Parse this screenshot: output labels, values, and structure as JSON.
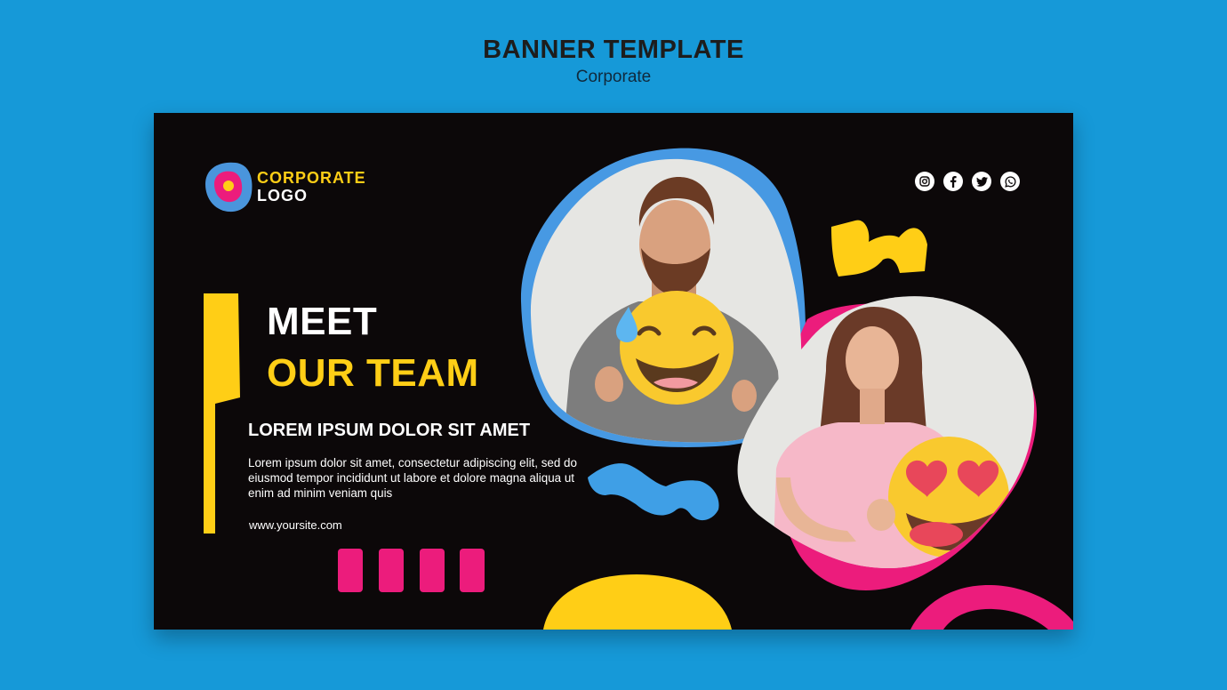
{
  "page": {
    "title": "BANNER TEMPLATE",
    "subtitle": "Corporate"
  },
  "banner": {
    "logo": {
      "line1": "CORPORATE",
      "line2": "LOGO"
    },
    "headline": {
      "line1": "MEET",
      "line2": "OUR TEAM"
    },
    "subheading": "LOREM IPSUM DOLOR SIT AMET",
    "body": "Lorem ipsum dolor sit amet, consectetur adipiscing elit, sed do eiusmod tempor incididunt ut labore et dolore magna aliqua ut enim ad minim veniam quis",
    "website": "www.yoursite.com",
    "social_icons": [
      "instagram-icon",
      "facebook-icon",
      "twitter-icon",
      "whatsapp-icon"
    ]
  },
  "colors": {
    "page_background": "#1699d8",
    "banner_background": "#0c0809",
    "accent_yellow": "#ffce16",
    "accent_pink": "#ec1c7c",
    "accent_blue": "#3f9fe6",
    "logo_blue": "#4a95dc",
    "photo_background": "#e6e6e3"
  }
}
